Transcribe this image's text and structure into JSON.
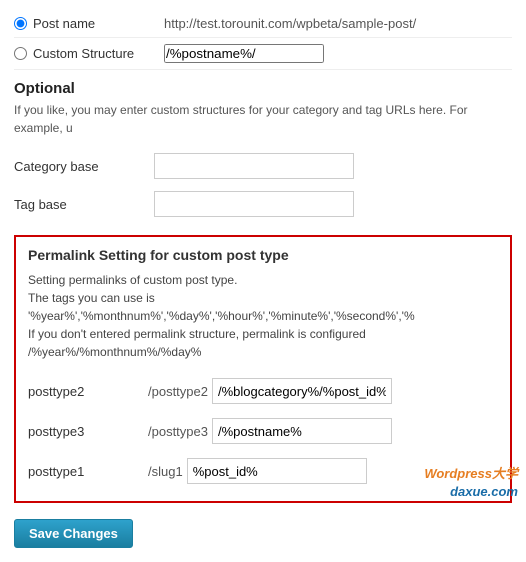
{
  "radio": {
    "post_name_label": "Post name",
    "post_name_url": "http://test.torounit.com/wpbeta/sample-post/",
    "custom_structure_label": "Custom Structure",
    "custom_structure_value": "/%postname%/"
  },
  "optional": {
    "heading": "Optional",
    "description": "If you like, you may enter custom structures for your category and tag URLs here. For example, u",
    "category_base_label": "Category base",
    "tag_base_label": "Tag base"
  },
  "cpt_section": {
    "title": "Permalink Setting for custom post type",
    "desc_line1": "Setting permalinks of custom post type.",
    "desc_line2": "The tags you can use is '%year%','%monthnum%','%day%','%hour%','%minute%','%second%','%",
    "desc_line3": "If you don't entered permalink structure, permalink is configured /%year%/%monthnum%/%day%",
    "rows": [
      {
        "name": "posttype2",
        "prefix": "/posttype2",
        "value": "/%blogcategory%/%post_id%"
      },
      {
        "name": "posttype3",
        "prefix": "/posttype3",
        "value": "/%postname%"
      },
      {
        "name": "posttype1",
        "prefix": "/slug1",
        "value": "%post_id%"
      }
    ]
  },
  "save_button": {
    "label": "Save Changes"
  },
  "watermark": {
    "line1": "Wordpress大学",
    "line2": "daxue.com"
  }
}
